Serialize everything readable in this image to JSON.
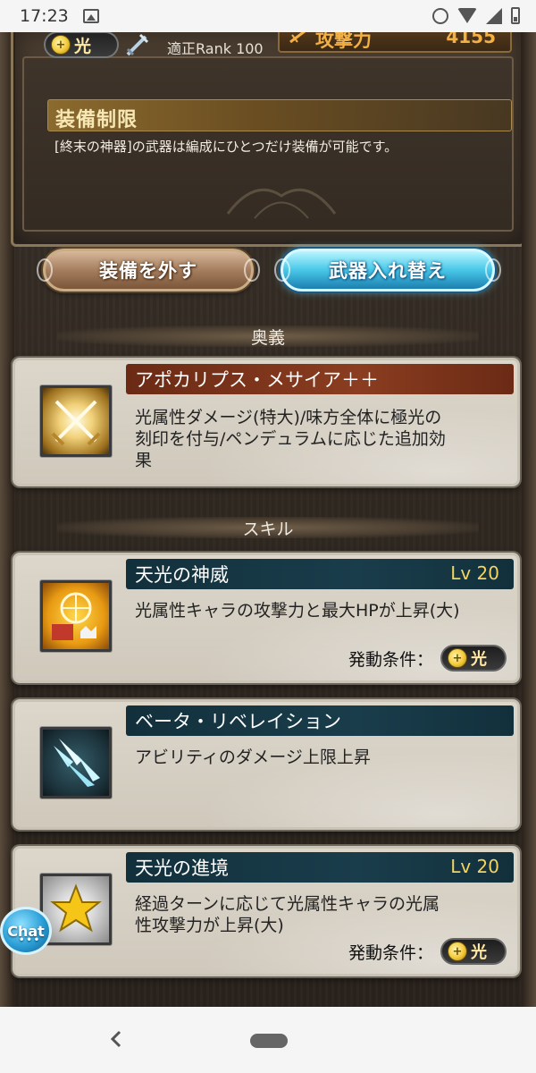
{
  "status_bar": {
    "time": "17:23",
    "icons": [
      "photo-icon",
      "alarm-icon",
      "wifi-icon",
      "signal-icon",
      "battery-icon"
    ]
  },
  "weapon_info": {
    "element": "光",
    "rank_text": "適正Rank 100",
    "attack_label": "攻撃力",
    "attack_value": "4155",
    "restriction_title": "装備制限",
    "restriction_desc": "[終末の神器]の武器は編成にひとつだけ装備が可能です。"
  },
  "buttons": {
    "unequip": "装備を外す",
    "swap": "武器入れ替え"
  },
  "sections": {
    "ougi": "奥義",
    "skill": "スキル"
  },
  "ougi": {
    "name": "アポカリプス・メサイア＋＋",
    "desc_line1": "光属性ダメージ(特大)/味方全体に極光の",
    "desc_line2": "刻印を付与/ペンデュラムに応じた追加効",
    "desc_line3": "果"
  },
  "skills": [
    {
      "name": "天光の神威",
      "level": "Lv 20",
      "desc_line1": "光属性キャラの攻撃力と最大HPが上昇(大)",
      "desc_line2": "",
      "condition_label": "発動条件：",
      "condition_element": "光"
    },
    {
      "name": "ベータ・リベレイション",
      "level": "",
      "desc_line1": "アビリティのダメージ上限上昇",
      "desc_line2": "",
      "condition_label": "",
      "condition_element": ""
    },
    {
      "name": "天光の進境",
      "level": "Lv 20",
      "desc_line1": "経過ターンに応じて光属性キャラの光属",
      "desc_line2": "性攻撃力が上昇(大)",
      "condition_label": "発動条件：",
      "condition_element": "光"
    }
  ],
  "chat": {
    "label": "Chat"
  },
  "colors": {
    "swap_button": "#48c7e8",
    "unequip_button": "#a57e5f",
    "ougi_title_bar": "#8a3d20",
    "skill_title_bar": "#1a3d4b",
    "level_text": "#f4d35e"
  }
}
